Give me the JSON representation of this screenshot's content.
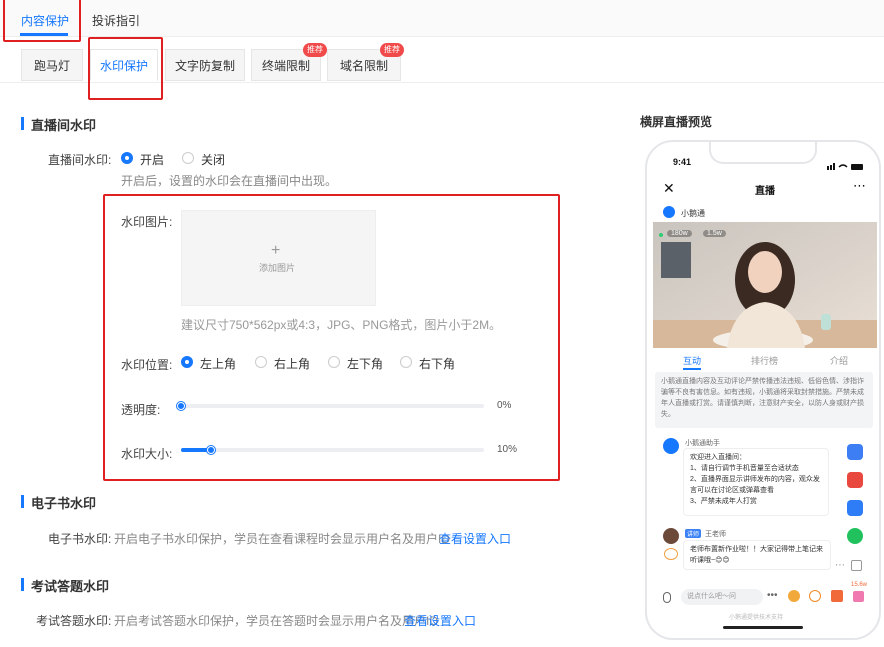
{
  "top_tabs": [
    {
      "label": "内容保护",
      "active": true
    },
    {
      "label": "投诉指引",
      "active": false
    }
  ],
  "sub_tabs": [
    {
      "label": "跑马灯"
    },
    {
      "label": "水印保护",
      "active": true
    },
    {
      "label": "文字防复制"
    },
    {
      "label": "终端限制",
      "badge": "推荐"
    },
    {
      "label": "域名限制",
      "badge": "推荐"
    }
  ],
  "live": {
    "section_title": "直播间水印",
    "label": "直播间水印:",
    "opt_on": "开启",
    "opt_off": "关闭",
    "tip": "开启后，设置的水印会在直播间中出现。",
    "image_label": "水印图片:",
    "upload_icon": "+",
    "upload_text": "添加图片",
    "image_tip": "建议尺寸750*562px或4:3，JPG、PNG格式，图片小于2M。",
    "position_label": "水印位置:",
    "positions": [
      "左上角",
      "右上角",
      "左下角",
      "右下角"
    ],
    "opacity_label": "透明度:",
    "opacity_value": "0%",
    "opacity_fraction": 0,
    "size_label": "水印大小:",
    "size_value": "10%",
    "size_fraction": 0.1
  },
  "ebook": {
    "section_title": "电子书水印",
    "label": "电子书水印:",
    "text": "开启电子书水印保护，学员在查看课程时会显示用户名及用户ID",
    "link": "查看设置入口"
  },
  "exam": {
    "section_title": "考试答题水印",
    "label": "考试答题水印:",
    "text": "开启考试答题水印保护，学员在答题时会显示用户名及用户ID",
    "link": "查看设置入口"
  },
  "preview": {
    "title": "横屏直播预览",
    "time": "9:41",
    "nav_title": "直播",
    "channel": "小鹅通",
    "stat1": "180w",
    "stat2": "1.5w",
    "tabs": [
      "互动",
      "排行榜",
      "介绍"
    ],
    "notice": "小鹅通直播内容及互动评论严禁传播违法违规、低俗色情、涉指诈骗等不良有害信息。如有违规，小鹅通将采取封禁措施。严禁未成年人直播或打赏。请谨慎判断，注意财产安全，以防人身或财产损失。",
    "assistant_name": "小鹅通助手",
    "assistant_msg": "欢迎进入直播间：\n1、请自行调节手机音量至合适状态\n2、直播界面显示讲师发布的内容，观众发言可以在讨论区或弹幕查看\n3、严禁未成年人打赏",
    "teacher_tag": "讲师",
    "teacher_name": "王老师",
    "teacher_msg": "老师布置新作业啦！！大家记得带上笔记来听课哦~😊😊",
    "input_placeholder": "说点什么吧～问",
    "likes": "15.6w",
    "footer": "小鹅通提供技术支持"
  },
  "colors": {
    "accent": "#1677ff",
    "highlight": "#e02020",
    "badge": "#f04a4a"
  }
}
